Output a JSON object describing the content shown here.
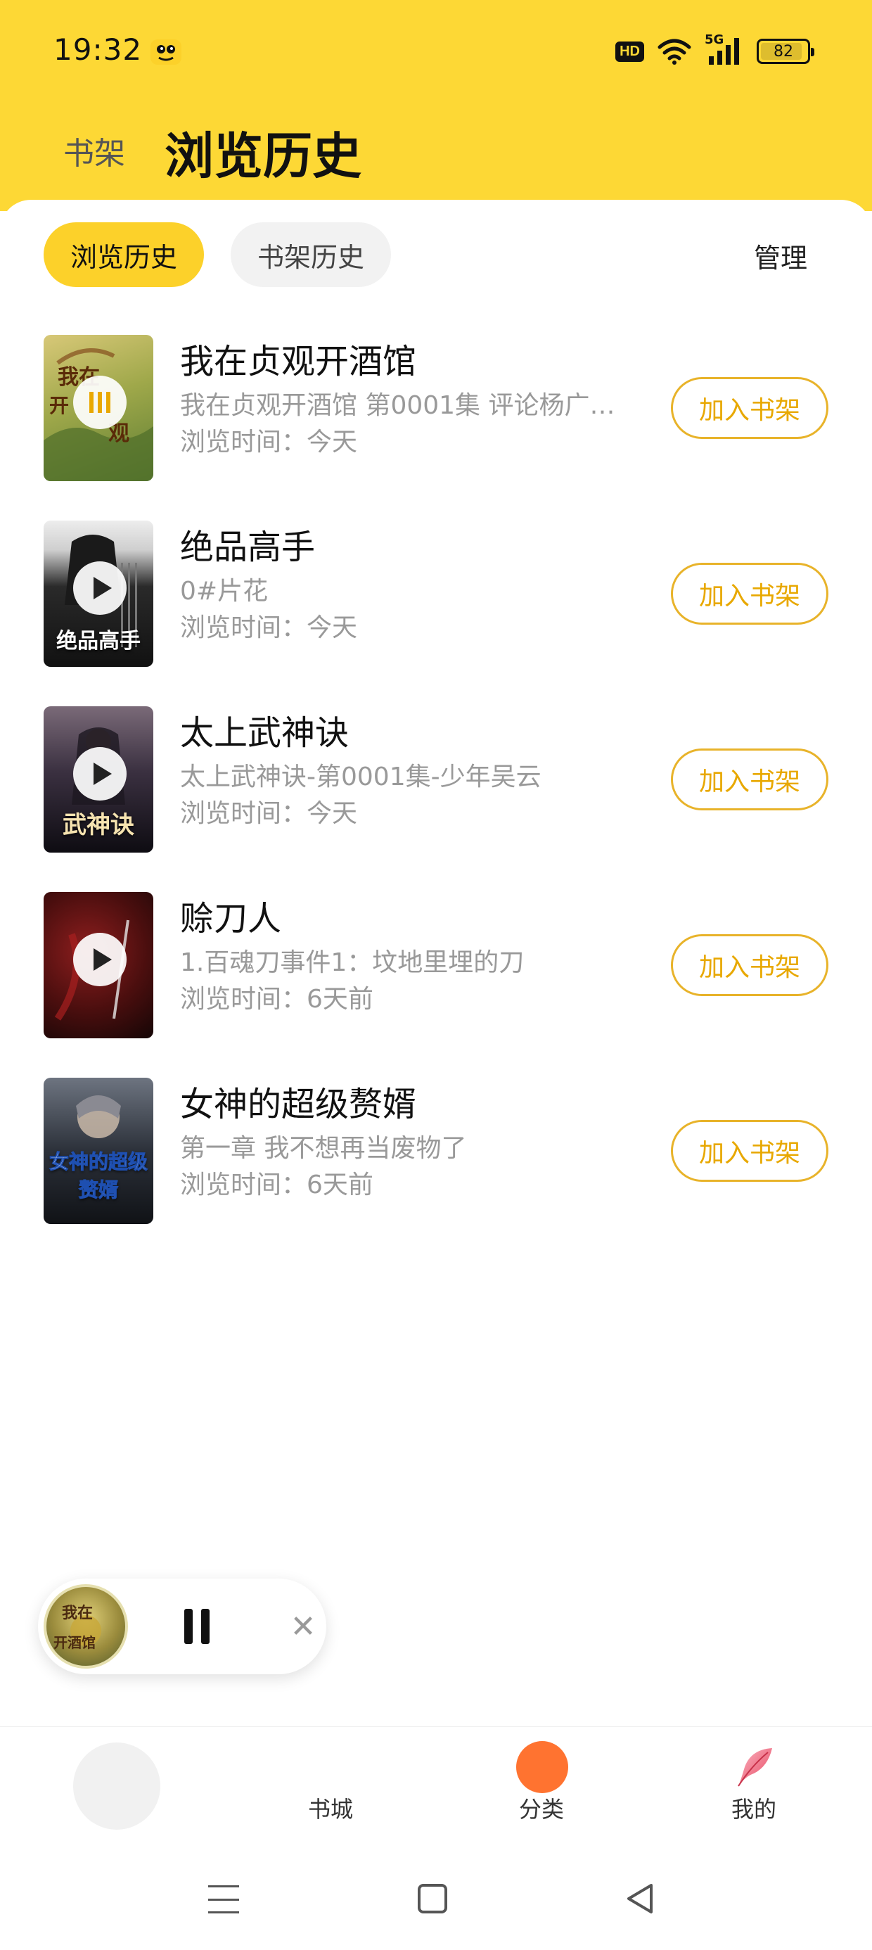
{
  "status_bar": {
    "time": "19:32",
    "hd": "HD",
    "network": "5G",
    "battery": "82",
    "icons": [
      "notification-app-icon",
      "wifi-icon",
      "signal-icon",
      "battery-icon"
    ]
  },
  "header": {
    "shelf_tab": "书架",
    "history_tab": "浏览历史"
  },
  "segment": {
    "active": "浏览历史",
    "inactive": "书架历史",
    "manage": "管理"
  },
  "books": [
    {
      "title": "我在贞观开酒馆",
      "subtitle": "我在贞观开酒馆 第0001集 评论杨广的...",
      "time": "浏览时间：今天",
      "button": "加入书架",
      "state": "playing",
      "cover_text": "",
      "cover_colors": [
        "#C8B866",
        "#6D8E3A"
      ]
    },
    {
      "title": "绝品高手",
      "subtitle": "0#片花",
      "time": "浏览时间：今天",
      "button": "加入书架",
      "state": "paused",
      "cover_text": "绝品高手",
      "cover_colors": [
        "#F2F2F2",
        "#1B1B1B"
      ]
    },
    {
      "title": "太上武神诀",
      "subtitle": "太上武神诀-第0001集-少年吴云",
      "time": "浏览时间：今天",
      "button": "加入书架",
      "state": "paused",
      "cover_text": "武神诀",
      "cover_colors": [
        "#6A5A68",
        "#16141A"
      ]
    },
    {
      "title": "赊刀人",
      "subtitle": "1.百魂刀事件1：坟地里埋的刀",
      "time": "浏览时间：6天前",
      "button": "加入书架",
      "state": "paused",
      "cover_text": "",
      "cover_colors": [
        "#6E1414",
        "#1A0A0A"
      ]
    },
    {
      "title": "女神的超级赘婿",
      "subtitle": "第一章  我不想再当废物了",
      "time": "浏览时间：6天前",
      "button": "加入书架",
      "state": "none",
      "cover_text": "女神的超级赘婿",
      "cover_colors": [
        "#5D6470",
        "#15181E"
      ]
    }
  ],
  "mini_player": {
    "state": "playing",
    "cover_text": "我在贞观开酒馆"
  },
  "tabbar": {
    "store": "书城",
    "category": "分类",
    "mine": "我的"
  },
  "colors": {
    "header_yellow": "#FDD835",
    "accent_yellow": "#FCD12A",
    "button_border": "#E8B32A",
    "category_orange": "#FF7330"
  }
}
